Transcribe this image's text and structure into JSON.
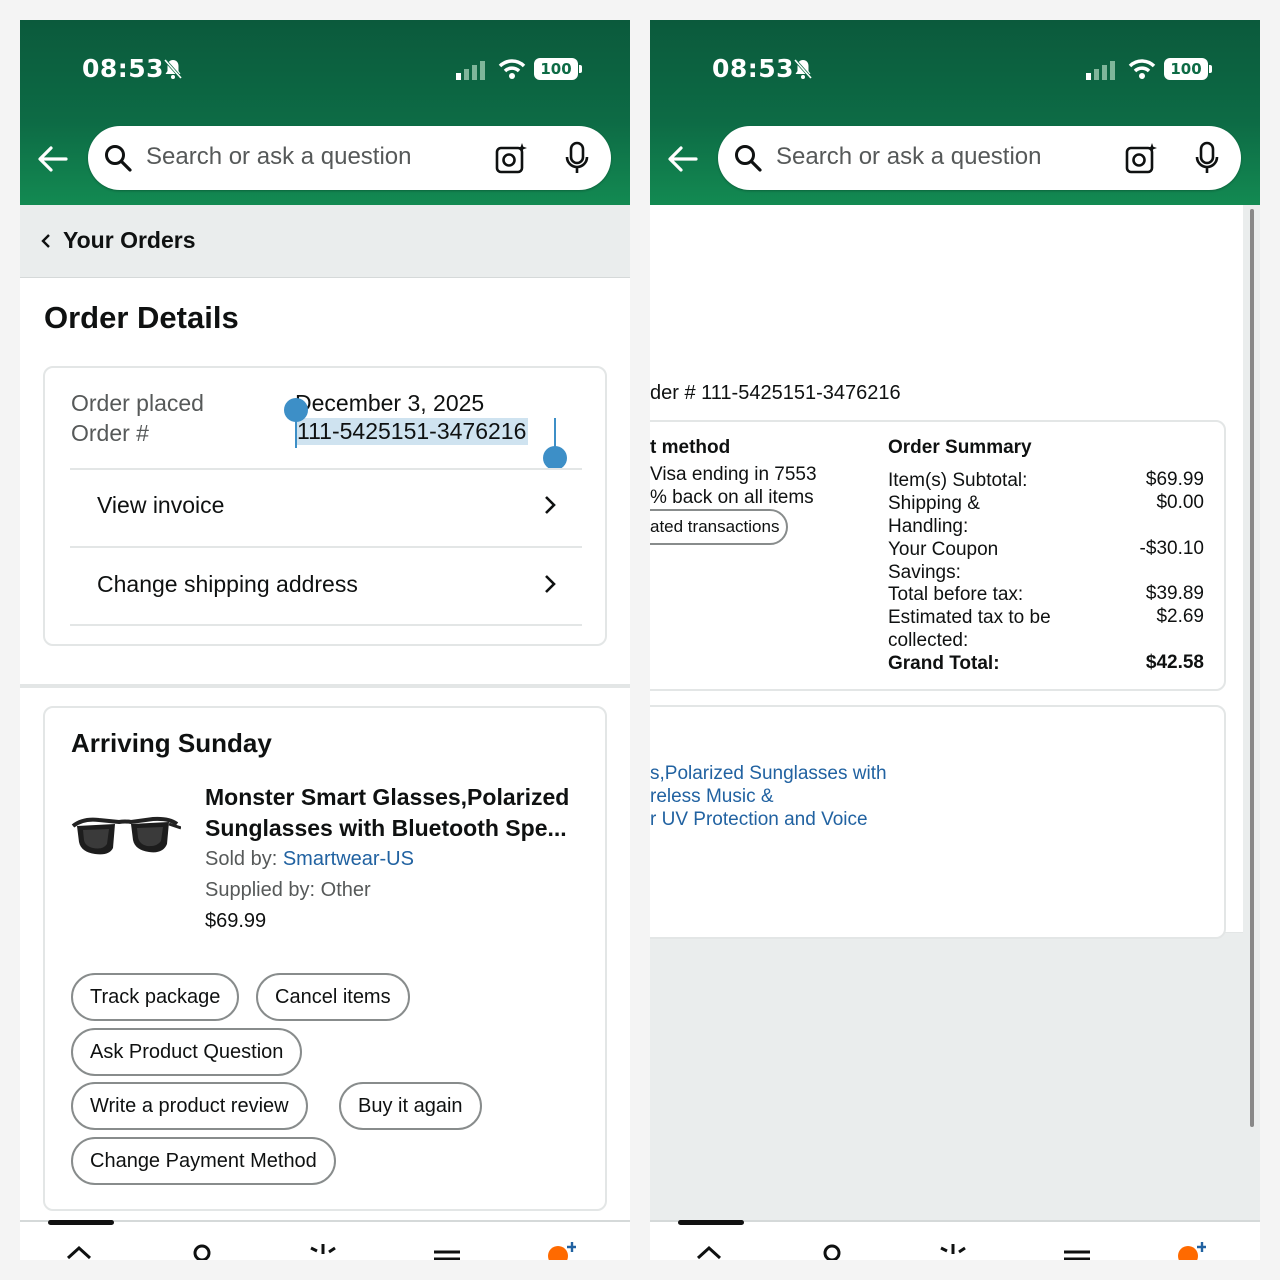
{
  "status_bar": {
    "time": "08:53",
    "battery": "100"
  },
  "search": {
    "placeholder": "Search or ask a question"
  },
  "left": {
    "breadcrumb": "Your Orders",
    "page_title": "Order Details",
    "order_info": {
      "placed_label": "Order placed",
      "placed_value": "December 3, 2025",
      "number_label": "Order #",
      "number_value": "111-5425151-3476216"
    },
    "links": {
      "view_invoice": "View invoice",
      "change_address": "Change shipping address"
    },
    "shipment": {
      "title": "Arriving Sunday",
      "product_title": "Monster Smart Glasses,Polarized Sunglasses with Bluetooth Spe...",
      "sold_by_label": "Sold by: ",
      "sold_by_value": "Smartwear-US",
      "supplied_by": "Supplied by: Other",
      "price": "$69.99"
    },
    "actions": {
      "track": "Track package",
      "cancel": "Cancel items",
      "ask": "Ask Product Question",
      "review": "Write a product review",
      "buy_again": "Buy it again",
      "change_payment": "Change Payment Method"
    }
  },
  "right": {
    "order_number": "der # 111-5425151-3476216",
    "payment": {
      "title": "t method",
      "card": "Visa  ending in 7553",
      "cashback": "% back on all items",
      "transactions": "ated transactions"
    },
    "summary": {
      "title": "Order Summary",
      "subtotal_label": "Item(s) Subtotal:",
      "subtotal": "$69.99",
      "shipping_label": "Shipping & Handling:",
      "shipping": "$0.00",
      "coupon_label": "Your Coupon Savings:",
      "coupon": "-$30.10",
      "before_tax_label": "Total before tax:",
      "before_tax": "$39.89",
      "tax_label": "Estimated tax to be collected:",
      "tax": "$2.69",
      "grand_label": "Grand Total:",
      "grand": "$42.58"
    },
    "item_link": {
      "line1": "s,Polarized Sunglasses with",
      "line2": "reless Music &",
      "line3": "r UV Protection and Voice"
    }
  },
  "bottom_nav": {
    "icons": [
      "chevron-up-icon",
      "user-icon",
      "sparkle-icon",
      "menu-icon",
      "rufus-icon"
    ]
  },
  "colors": {
    "header_green": "#0d6b45",
    "link_blue": "#2162a1",
    "selection": "#3d8fc7",
    "accent_orange": "#ff6a00"
  }
}
